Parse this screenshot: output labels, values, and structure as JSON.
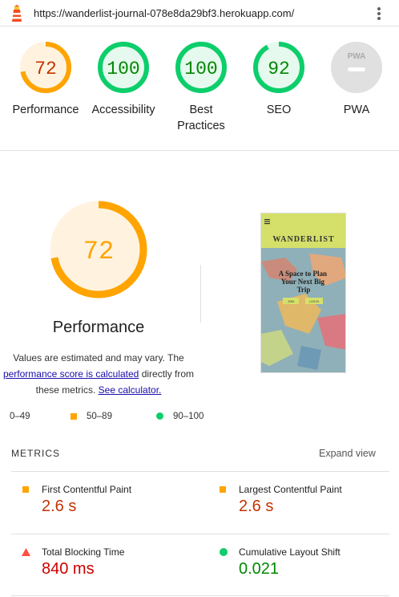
{
  "browser": {
    "url": "https://wanderlist-journal-078e8da29bf3.herokuapp.com/"
  },
  "colors": {
    "average": "#ffa400",
    "average_text": "#c33300",
    "pass": "#0cce6b",
    "pass_text": "#008800",
    "fail": "#ff4e42",
    "fail_text": "#cc0000",
    "na": "#cccccc"
  },
  "gauges": [
    {
      "label": "Performance",
      "score": 72,
      "rating": "average"
    },
    {
      "label": "Accessibility",
      "score": 100,
      "rating": "pass"
    },
    {
      "label": "Best Practices",
      "score": 100,
      "rating": "pass"
    },
    {
      "label": "SEO",
      "score": 92,
      "rating": "pass"
    },
    {
      "label": "PWA",
      "score": "",
      "rating": "na"
    }
  ],
  "pwa_badge": "PWA",
  "performance": {
    "score": "72",
    "title": "Performance",
    "desc_before": "Values are estimated and may vary. The",
    "desc_link": "performance score is calculated",
    "desc_after": "directly from these metrics.",
    "calculator_link": "See calculator."
  },
  "legend": {
    "fail": "0–49",
    "average": "50–89",
    "pass": "90–100"
  },
  "screenshot": {
    "brand": "WANDERLIST",
    "headline": "A Space to Plan Your Next Big Trip",
    "button1": "JOIN",
    "button2": "LOG IN"
  },
  "metrics": {
    "heading": "METRICS",
    "expand_label": "Expand view",
    "items": [
      {
        "label": "First Contentful Paint",
        "value": "2.6 s",
        "rating": "average"
      },
      {
        "label": "Largest Contentful Paint",
        "value": "2.6 s",
        "rating": "average"
      },
      {
        "label": "Total Blocking Time",
        "value": "840 ms",
        "rating": "fail"
      },
      {
        "label": "Cumulative Layout Shift",
        "value": "0.021",
        "rating": "pass"
      }
    ]
  }
}
